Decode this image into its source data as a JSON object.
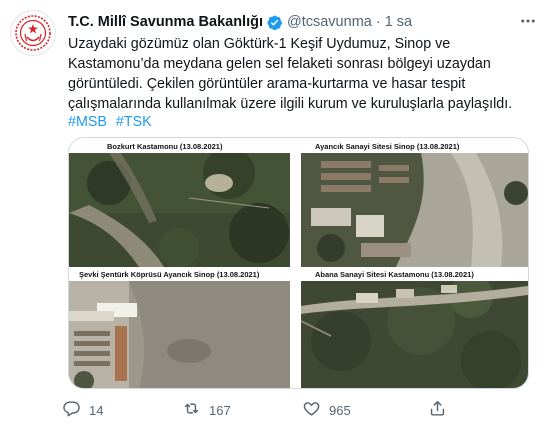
{
  "account": {
    "name": "T.C. Millî Savunma Bakanlığı",
    "handle": "@tcsavunma",
    "separator": "·",
    "time": "1 sa"
  },
  "tweet": {
    "text": "Uzaydaki gözümüz olan Göktürk-1 Keşif Uydumuz, Sinop ve Kastamonu’da meydana gelen sel felaketi sonrası bölgeyi uzaydan görüntüledi. Çekilen görüntüler arama-kurtarma ve hasar tespit çalışmalarında kullanılmak üzere ilgili kurum ve kuruluşlarla paylaşıldı.",
    "hashtags": [
      "#MSB",
      "#TSK"
    ]
  },
  "media": {
    "panels": [
      {
        "caption": "Bozkurt Kastamonu (13.08.2021)"
      },
      {
        "caption": "Ayancık Sanayi Sitesi Sinop (13.08.2021)"
      },
      {
        "caption": "Şevki Şentürk Köprüsü Ayancık Sinop (13.08.2021)"
      },
      {
        "caption": "Abana Sanayi Sitesi Kastamonu (13.08.2021)"
      }
    ]
  },
  "actions": {
    "replies": "14",
    "retweets": "167",
    "likes": "965"
  },
  "colors": {
    "link": "#1d9bf0",
    "verified": "#1d9bf0",
    "muted": "#536471",
    "seal_red": "#d8232a"
  },
  "icons": [
    "verified-badge-icon",
    "more-icon",
    "reply-icon",
    "retweet-icon",
    "like-icon",
    "share-icon"
  ]
}
